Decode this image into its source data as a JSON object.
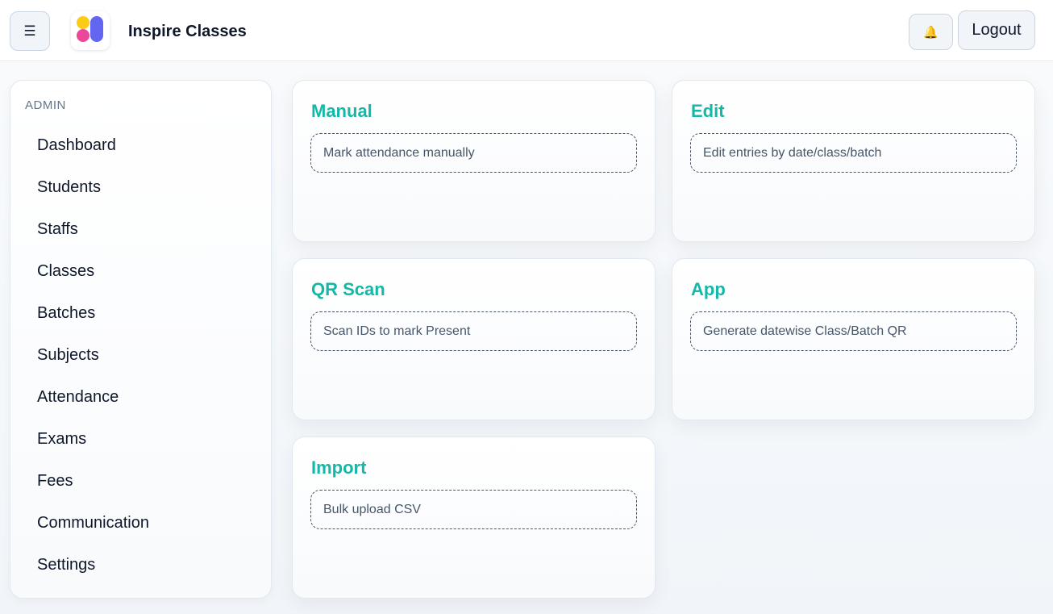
{
  "header": {
    "menu_icon": "☰",
    "app_title": "Inspire Classes",
    "bell_icon": "🔔",
    "logout_label": "Logout",
    "logo_colors": [
      "#facc15",
      "#ec4899",
      "#6366f1"
    ]
  },
  "sidebar": {
    "heading": "ADMIN",
    "items": [
      {
        "label": "Dashboard"
      },
      {
        "label": "Students"
      },
      {
        "label": "Staffs"
      },
      {
        "label": "Classes"
      },
      {
        "label": "Batches"
      },
      {
        "label": "Subjects"
      },
      {
        "label": "Attendance"
      },
      {
        "label": "Exams"
      },
      {
        "label": "Fees"
      },
      {
        "label": "Communication"
      },
      {
        "label": "Settings"
      }
    ]
  },
  "cards": [
    {
      "title": "Manual",
      "description": "Mark attendance manually"
    },
    {
      "title": "Edit",
      "description": "Edit entries by date/class/batch"
    },
    {
      "title": "QR Scan",
      "description": "Scan IDs to mark Present"
    },
    {
      "title": "App",
      "description": "Generate datewise Class/Batch QR"
    },
    {
      "title": "Import",
      "description": "Bulk upload CSV"
    }
  ],
  "colors": {
    "accent": "#14b8a6",
    "border": "#e2e8f0",
    "text": "#0f172a",
    "muted": "#64748b"
  }
}
